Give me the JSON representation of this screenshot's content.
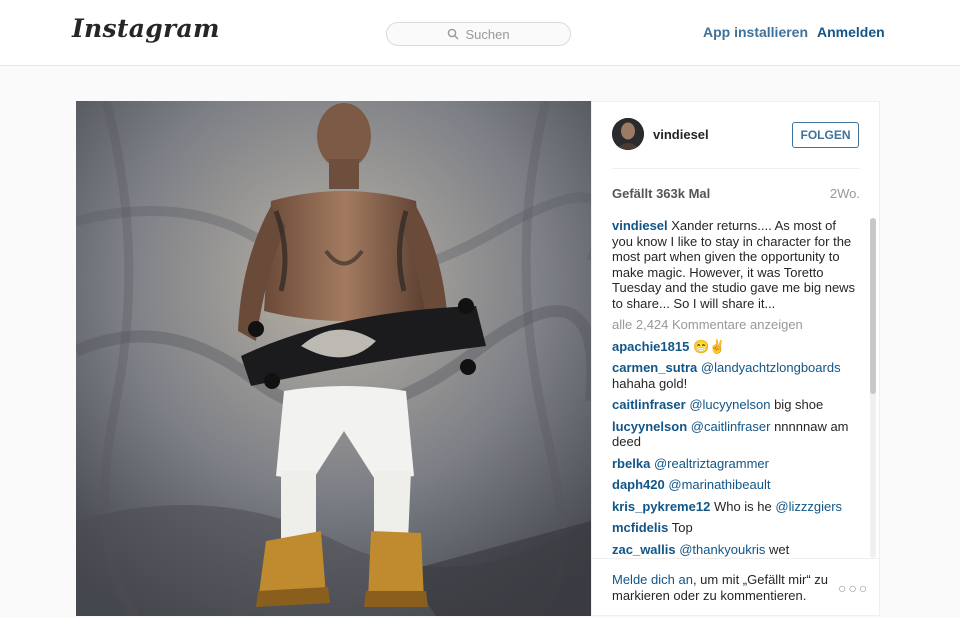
{
  "header": {
    "logo_text": "Instagram",
    "search_placeholder": "Suchen",
    "app_link": "App installieren",
    "login_link": "Anmelden"
  },
  "post": {
    "username": "vindiesel",
    "follow_label": "FOLGEN",
    "likes": "Gefällt 363k Mal",
    "time": "2Wo.",
    "caption": "Xander returns.... As most of you know I like to stay in character for the most part when given the opportunity to make magic. However, it was Toretto Tuesday and the studio gave me big news to share... So I will share it...",
    "view_all": "alle 2,424 Kommentare anzeigen",
    "comments": [
      {
        "user": "apachie1815",
        "mention": "",
        "text": "😁✌"
      },
      {
        "user": "carmen_sutra",
        "mention": "@landyachtzlongboards",
        "text": "hahaha gold!"
      },
      {
        "user": "caitlinfraser",
        "mention": "@lucyynelson",
        "text": "big shoe"
      },
      {
        "user": "lucyynelson",
        "mention": "@caitlinfraser",
        "text": "nnnnnaw am deed"
      },
      {
        "user": "rbelka",
        "mention": "@realtriztagrammer",
        "text": ""
      },
      {
        "user": "daph420",
        "mention": "@marinathibeault",
        "text": ""
      },
      {
        "user": "kris_pykreme12",
        "mention": "",
        "text": "Who is he",
        "mention2": "@lizzzgiers"
      },
      {
        "user": "mcfidelis",
        "mention": "",
        "text": "Top"
      },
      {
        "user": "zac_wallis",
        "mention": "@thankyoukris",
        "text": "wet"
      }
    ],
    "login_prompt_link": "Melde dich an",
    "login_prompt_rest": ", um mit „Gefällt mir“ zu markieren oder zu kommentieren.",
    "more_options": "○○○"
  }
}
